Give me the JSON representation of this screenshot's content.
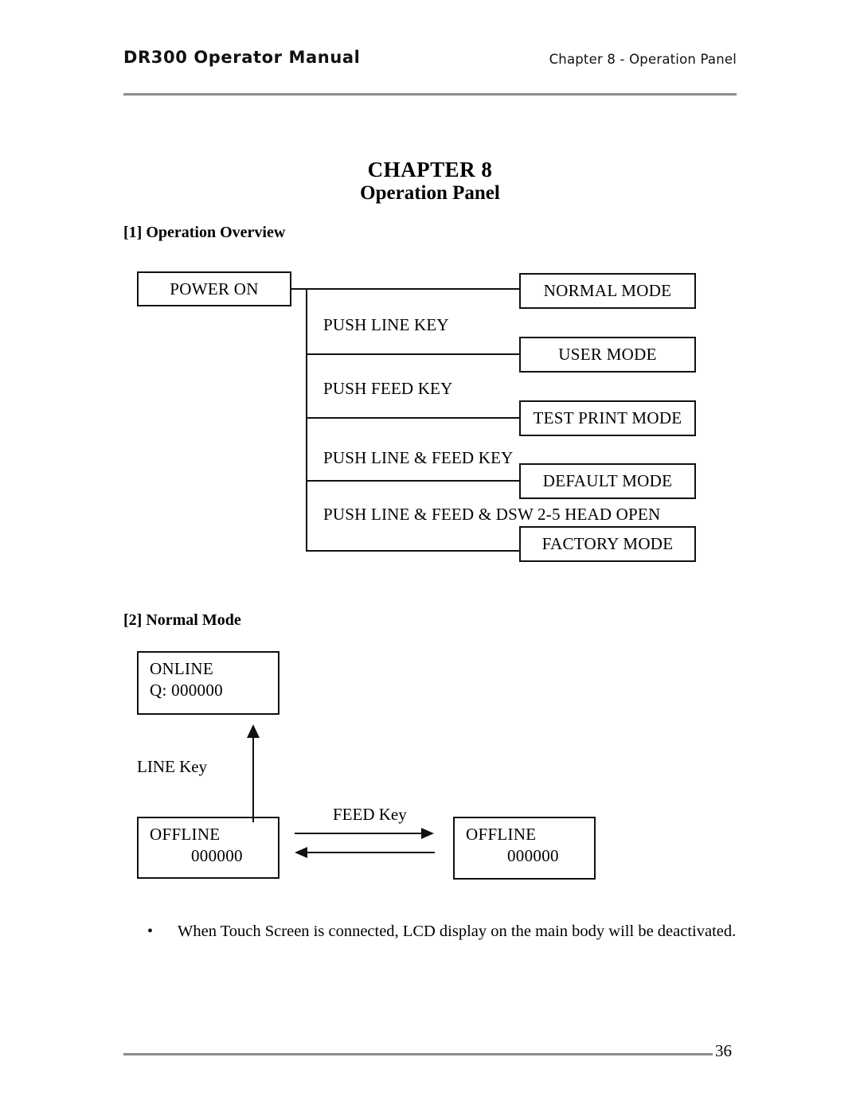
{
  "header": {
    "left_title": "DR300 Operator Manual",
    "right_title": "Chapter 8 - Operation Panel",
    "rule_color": "#8d8d85"
  },
  "title": {
    "chapter": "CHAPTER 8",
    "subtitle": "Operation Panel"
  },
  "sections": [
    {
      "heading": "[1] Operation Overview"
    },
    {
      "heading": "[2] Normal Mode"
    }
  ],
  "operation_overview": {
    "source_box": "POWER ON",
    "branches": [
      {
        "label": "",
        "mode": "NORMAL MODE"
      },
      {
        "label": "PUSH LINE KEY",
        "mode": "USER MODE"
      },
      {
        "label": "PUSH FEED KEY",
        "mode": "TEST PRINT MODE"
      },
      {
        "label": "PUSH LINE & FEED KEY",
        "mode": "DEFAULT MODE"
      },
      {
        "label": "PUSH LINE & FEED & DSW 2-5 HEAD OPEN",
        "mode": "FACTORY MODE"
      }
    ]
  },
  "normal_mode": {
    "online_box": {
      "line1": "ONLINE",
      "line2": "Q: 000000"
    },
    "offline_box_left": {
      "line1": "OFFLINE",
      "line2": "000000"
    },
    "offline_box_right": {
      "line1": "OFFLINE",
      "line2": "000000"
    },
    "line_key_label": "LINE Key",
    "feed_key_label": "FEED Key"
  },
  "note": {
    "bullet": "•",
    "text": "When Touch Screen is connected, LCD display on the main body will be deactivated."
  },
  "footer": {
    "page_number": "36",
    "rule_color": "#8d8d85"
  }
}
